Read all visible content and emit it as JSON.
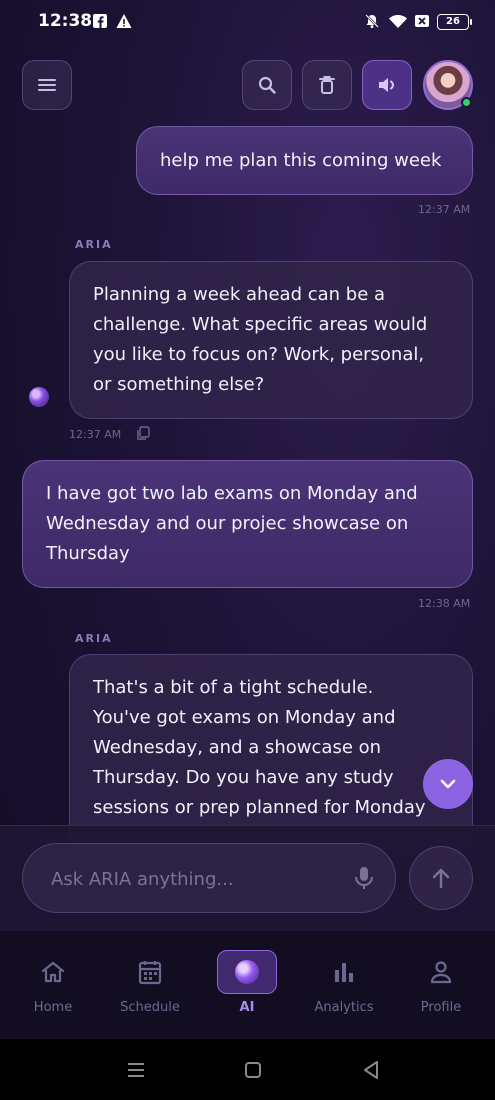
{
  "status_bar": {
    "time": "12:38",
    "battery": "26"
  },
  "header": {
    "menu_icon": "menu-icon",
    "search_icon": "search-icon",
    "delete_icon": "trash-icon",
    "speaker_icon": "speaker-icon"
  },
  "assistant_name": "ARIA",
  "messages": [
    {
      "role": "user",
      "text": "help me plan this coming week",
      "time": "12:37 AM"
    },
    {
      "role": "assistant",
      "label": "ARIA",
      "lines": [
        "Planning a week ahead can be a",
        "challenge. What specific areas would",
        "you like to focus on? Work, personal,",
        "or something else?"
      ],
      "time": "12:37 AM"
    },
    {
      "role": "user",
      "lines": [
        "I have got two lab exams on Monday and",
        "Wednesday and our projec showcase on",
        "Thursday"
      ],
      "time": "12:38 AM"
    },
    {
      "role": "assistant",
      "label": "ARIA",
      "lines": [
        "That's a bit of a tight schedule.",
        "You've got exams on Monday and",
        "Wednesday, and a showcase on",
        "Thursday. Do you have any study",
        "sessions or prep planned for Monday"
      ]
    }
  ],
  "composer": {
    "placeholder": "Ask ARIA anything..."
  },
  "nav": [
    {
      "label": "Home",
      "icon": "home-icon"
    },
    {
      "label": "Schedule",
      "icon": "calendar-icon"
    },
    {
      "label": "AI",
      "icon": "ai-orb-icon",
      "active": true
    },
    {
      "label": "Analytics",
      "icon": "bar-chart-icon"
    },
    {
      "label": "Profile",
      "icon": "person-icon"
    }
  ],
  "colors": {
    "accent": "#8c63e0",
    "background": "#1c1336",
    "online": "#2fd36b"
  }
}
